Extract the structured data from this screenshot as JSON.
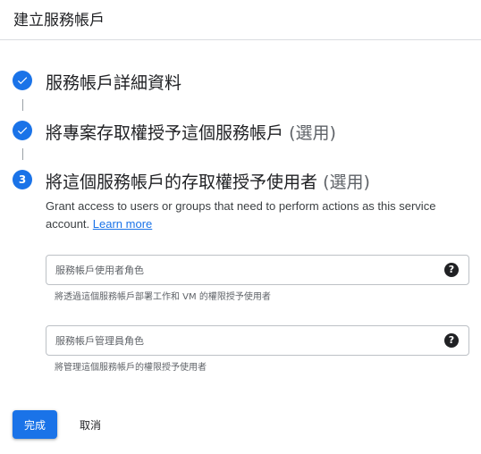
{
  "header": {
    "title": "建立服務帳戶"
  },
  "steps": [
    {
      "number": "",
      "status": "completed",
      "icon": "check-icon",
      "title": "服務帳戶詳細資料",
      "optional": ""
    },
    {
      "number": "",
      "status": "completed",
      "icon": "check-icon",
      "title": "將專案存取權授予這個服務帳戶",
      "optional": "(選用)"
    },
    {
      "number": "3",
      "status": "active",
      "icon": "",
      "title": "將這個服務帳戶的存取權授予使用者",
      "optional": "(選用)"
    }
  ],
  "step3": {
    "description": "Grant access to users or groups that need to perform actions as this service account.",
    "learn_more": "Learn more",
    "fields": [
      {
        "placeholder": "服務帳戶使用者角色",
        "value": "",
        "help_icon": "help-icon",
        "hint": "將透過這個服務帳戶部署工作和 VM 的權限授予使用者"
      },
      {
        "placeholder": "服務帳戶管理員角色",
        "value": "",
        "help_icon": "help-icon",
        "hint": "將管理這個服務帳戶的權限授予使用者"
      }
    ]
  },
  "actions": {
    "done_label": "完成",
    "cancel_label": "取消"
  },
  "colors": {
    "accent": "#1a73e8",
    "text": "#202124",
    "muted": "#5f6368",
    "border": "#dadce0"
  }
}
